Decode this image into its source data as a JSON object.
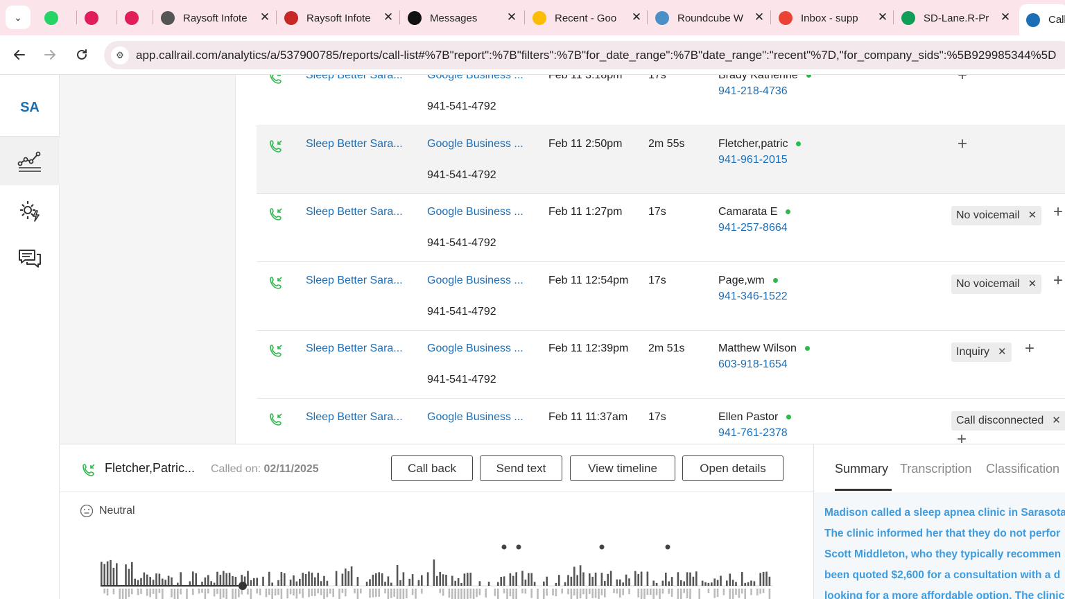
{
  "browser": {
    "tabs": [
      {
        "title": "",
        "icon": "whatsapp-icon",
        "color": "#25d366"
      },
      {
        "title": "",
        "icon": "slack-icon",
        "color": "#e01e5a"
      },
      {
        "title": "",
        "icon": "slack-icon",
        "color": "#e01e5a"
      },
      {
        "title": "Raysoft Infote",
        "icon": "globe-icon",
        "color": "#555555"
      },
      {
        "title": "Raysoft Infote",
        "icon": "school-icon",
        "color": "#c62828"
      },
      {
        "title": "Messages",
        "icon": "upwork-icon",
        "color": "#111111"
      },
      {
        "title": "Recent - Goo",
        "icon": "google-drive-icon",
        "color": "#fbbc04"
      },
      {
        "title": "Roundcube W",
        "icon": "roundcube-icon",
        "color": "#4a90c8"
      },
      {
        "title": "Inbox - supp",
        "icon": "gmail-icon",
        "color": "#ea4335"
      },
      {
        "title": "SD-Lane.R-Pr",
        "icon": "sheets-icon",
        "color": "#0f9d58"
      },
      {
        "title": "Call",
        "icon": "callrail-icon",
        "color": "#1d6fb5"
      }
    ],
    "url": "app.callrail.com/analytics/a/537900785/reports/call-list#%7B\"report\":%7B\"filters\":%7B\"for_date_range\":%7B\"date_range\":\"recent\"%7D,\"for_company_sids\":%5B929985344%5D"
  },
  "sidebar": {
    "account_initials": "SA"
  },
  "calls": [
    {
      "company": "Sleep Better Sara...",
      "source": "Google Business ...",
      "tracking_number": "941-541-4792",
      "date": "Feb 11 3:18pm",
      "duration": "17s",
      "caller": "Brady Katherine",
      "phone": "941-218-4736",
      "tag": ""
    },
    {
      "company": "Sleep Better Sara...",
      "source": "Google Business ...",
      "tracking_number": "941-541-4792",
      "date": "Feb 11 2:50pm",
      "duration": "2m 55s",
      "caller": "Fletcher,patric",
      "phone": "941-961-2015",
      "tag": ""
    },
    {
      "company": "Sleep Better Sara...",
      "source": "Google Business ...",
      "tracking_number": "941-541-4792",
      "date": "Feb 11 1:27pm",
      "duration": "17s",
      "caller": "Camarata E",
      "phone": "941-257-8664",
      "tag": "No voicemail"
    },
    {
      "company": "Sleep Better Sara...",
      "source": "Google Business ...",
      "tracking_number": "941-541-4792",
      "date": "Feb 11 12:54pm",
      "duration": "17s",
      "caller": "Page,wm",
      "phone": "941-346-1522",
      "tag": "No voicemail"
    },
    {
      "company": "Sleep Better Sara...",
      "source": "Google Business ...",
      "tracking_number": "941-541-4792",
      "date": "Feb 11 12:39pm",
      "duration": "2m 51s",
      "caller": "Matthew Wilson",
      "phone": "603-918-1654",
      "tag": "Inquiry"
    },
    {
      "company": "Sleep Better Sara...",
      "source": "Google Business ...",
      "tracking_number": "",
      "date": "Feb 11 11:37am",
      "duration": "17s",
      "caller": "Ellen Pastor",
      "phone": "941-761-2378",
      "tag": "Call disconnected"
    }
  ],
  "detail": {
    "caller_name": "Fletcher,Patric...",
    "called_on_label": "Called on:",
    "called_on_date": "02/11/2025",
    "buttons": {
      "call_back": "Call back",
      "send_text": "Send text",
      "view_timeline": "View timeline",
      "open_details": "Open details"
    },
    "sentiment": "Neutral",
    "tabs": {
      "summary": "Summary",
      "transcription": "Transcription",
      "classification": "Classification"
    },
    "summary_lines": [
      "Madison called a sleep apnea clinic in Sarasota",
      "The clinic informed her that they do not perfor",
      "Scott Middleton, who they typically recommen",
      "been quoted $2,600 for a consultation with a d",
      "looking for a more affordable option. The clinic"
    ]
  },
  "colors": {
    "link": "#1d6fb5",
    "online_dot": "#2eb84e",
    "summary_text": "#3d9be0",
    "tabbar": "#fbe5ea"
  }
}
